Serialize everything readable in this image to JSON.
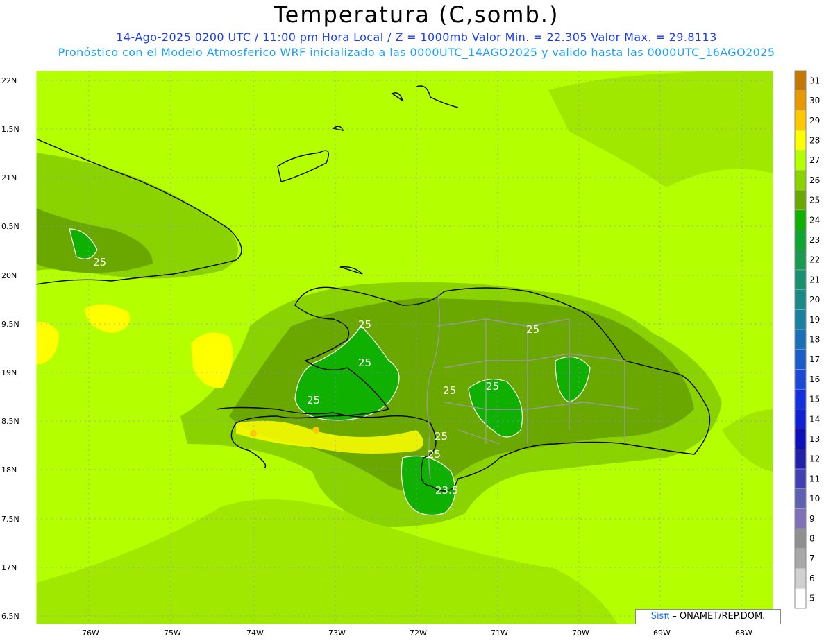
{
  "title": "Temperatura (C,somb.)",
  "subtitle_line1": "14-Ago-2025 0200 UTC / 11:00 pm Hora Local / Z = 1000mb   Valor Min. = 22.305  Valor Max. = 29.8113",
  "subtitle_line2": "Pronóstico con el Modelo Atmosferico WRF inicializado a las 0000UTC_14AGO2025 y valido hasta las  0000UTC_16AGO2025",
  "lat_labels": [
    "22N",
    "1.5N",
    "21N",
    "0.5N",
    "20N",
    "9.5N",
    "19N",
    "8.5N",
    "18N",
    "7.5N",
    "17N",
    "6.5N"
  ],
  "lon_labels": [
    "76W",
    "75W",
    "74W",
    "73W",
    "72W",
    "71W",
    "70W",
    "69W",
    "68W"
  ],
  "colorbar": {
    "levels": [
      "31",
      "30",
      "29",
      "28",
      "27",
      "26",
      "25",
      "24",
      "23",
      "22",
      "21",
      "20",
      "19",
      "18",
      "17",
      "16",
      "15",
      "14",
      "13",
      "12",
      "11",
      "10",
      "9",
      "8",
      "7",
      "6",
      "5"
    ],
    "colors": [
      "#c47800",
      "#e69900",
      "#ffc800",
      "#ffff00",
      "#b4ff00",
      "#8ad200",
      "#6aa800",
      "#10b000",
      "#10a430",
      "#1a9a50",
      "#1a9070",
      "#1a8a88",
      "#1a80a0",
      "#1a70b4",
      "#1a5cc8",
      "#1a48d8",
      "#1230e0",
      "#1020d0",
      "#1010b8",
      "#2020a8",
      "#4040b0",
      "#6060b0",
      "#8070b8",
      "#909090",
      "#a8a8a8",
      "#d0d0d0",
      "#ffffff"
    ]
  },
  "contour_labels": [
    "25",
    "25",
    "25",
    "25",
    "25",
    "25",
    "25",
    "25",
    "25",
    "23.5"
  ],
  "credit": {
    "sis": "Sisπ",
    "rest": " – ONAMET/REP.DOM."
  }
}
